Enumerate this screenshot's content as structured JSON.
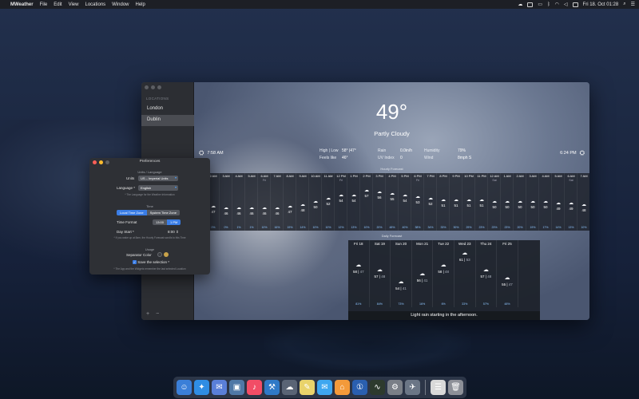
{
  "menubar": {
    "app_name": "MWeather",
    "menus": [
      "File",
      "Edit",
      "View",
      "Locations",
      "Window",
      "Help"
    ],
    "clock": "Fri 18. Oct 01:28"
  },
  "sidebar": {
    "header": "LOCATIONS",
    "items": [
      {
        "label": "London",
        "selected": false
      },
      {
        "label": "Dublin",
        "selected": true
      }
    ],
    "add": "+",
    "remove": "−"
  },
  "current": {
    "temperature": "49°",
    "condition": "Partly Cloudy",
    "sunrise": "7:58 AM",
    "sunset": "6:24 PM",
    "high_low_label": "High | Low",
    "high_low_value": "58° |47°",
    "feels_like_label": "Feels like",
    "feels_like_value": "46°",
    "rain_label": "Rain",
    "rain_value": "0.0in/h",
    "uv_label": "UV Index",
    "uv_value": "0",
    "humidity_label": "Humidity",
    "humidity_value": "79%",
    "wind_label": "Wind",
    "wind_value": "8mph S"
  },
  "hourly": {
    "title": "Hourly Forecast",
    "hours": [
      {
        "t": "1 AM",
        "d": "",
        "temp": "49",
        "rain": "1%"
      },
      {
        "t": "2 AM",
        "d": "",
        "temp": "47",
        "rain": "0%"
      },
      {
        "t": "3 AM",
        "d": "",
        "temp": "46",
        "rain": "0%"
      },
      {
        "t": "4 AM",
        "d": "",
        "temp": "46",
        "rain": "1%"
      },
      {
        "t": "5 AM",
        "d": "",
        "temp": "46",
        "rain": "1%"
      },
      {
        "t": "6 AM",
        "d": "Fri",
        "temp": "46",
        "rain": "10%"
      },
      {
        "t": "7 AM",
        "d": "",
        "temp": "46",
        "rain": "16%"
      },
      {
        "t": "8 AM",
        "d": "",
        "temp": "47",
        "rain": "19%"
      },
      {
        "t": "9 AM",
        "d": "",
        "temp": "48",
        "rain": "14%"
      },
      {
        "t": "10 AM",
        "d": "",
        "temp": "50",
        "rain": "10%"
      },
      {
        "t": "11 AM",
        "d": "",
        "temp": "52",
        "rain": "10%"
      },
      {
        "t": "12 PM",
        "d": "Fri",
        "temp": "54",
        "rain": "12%"
      },
      {
        "t": "1 PM",
        "d": "",
        "temp": "54",
        "rain": "13%"
      },
      {
        "t": "2 PM",
        "d": "",
        "temp": "57",
        "rain": "10%"
      },
      {
        "t": "3 PM",
        "d": "",
        "temp": "56",
        "rain": "20%"
      },
      {
        "t": "4 PM",
        "d": "",
        "temp": "55",
        "rain": "48%"
      },
      {
        "t": "5 PM",
        "d": "",
        "temp": "54",
        "rain": "40%"
      },
      {
        "t": "6 PM",
        "d": "Fri",
        "temp": "53",
        "rain": "38%"
      },
      {
        "t": "7 PM",
        "d": "",
        "temp": "52",
        "rain": "34%"
      },
      {
        "t": "8 PM",
        "d": "",
        "temp": "51",
        "rain": "33%"
      },
      {
        "t": "9 PM",
        "d": "",
        "temp": "51",
        "rain": "30%"
      },
      {
        "t": "10 PM",
        "d": "",
        "temp": "51",
        "rain": "29%"
      },
      {
        "t": "11 PM",
        "d": "",
        "temp": "51",
        "rain": "23%"
      },
      {
        "t": "12 AM",
        "d": "Sat",
        "temp": "50",
        "rain": "23%"
      },
      {
        "t": "1 AM",
        "d": "",
        "temp": "50",
        "rain": "23%"
      },
      {
        "t": "2 AM",
        "d": "",
        "temp": "50",
        "rain": "20%"
      },
      {
        "t": "3 AM",
        "d": "",
        "temp": "50",
        "rain": "19%"
      },
      {
        "t": "4 AM",
        "d": "",
        "temp": "50",
        "rain": "17%"
      },
      {
        "t": "5 AM",
        "d": "",
        "temp": "49",
        "rain": "14%"
      },
      {
        "t": "6 AM",
        "d": "Sat",
        "temp": "49",
        "rain": "13%"
      },
      {
        "t": "7 AM",
        "d": "",
        "temp": "48",
        "rain": "10%"
      }
    ]
  },
  "daily": {
    "title": "Daily Forecast",
    "days": [
      {
        "d": "Fri 18",
        "hi": "58",
        "lo": "47",
        "rain": "81%"
      },
      {
        "d": "Sat 19",
        "hi": "57",
        "lo": "48",
        "rain": "84%"
      },
      {
        "d": "Sun 20",
        "hi": "54",
        "lo": "41",
        "rain": "73%"
      },
      {
        "d": "Mon 21",
        "hi": "56",
        "lo": "41",
        "rain": "16%"
      },
      {
        "d": "Tue 22",
        "hi": "58",
        "lo": "48",
        "rain": "6%"
      },
      {
        "d": "Wed 23",
        "hi": "61",
        "lo": "53",
        "rain": "33%"
      },
      {
        "d": "Thu 24",
        "hi": "57",
        "lo": "48",
        "rain": "57%"
      },
      {
        "d": "Fri 25",
        "hi": "55",
        "lo": "47",
        "rain": "48%"
      }
    ],
    "summary": "Light rain starting in the afternoon."
  },
  "prefs": {
    "title": "Preferences",
    "units_header": "Units / Language",
    "units_label": "Units",
    "units_value": "US – Imperial Units",
    "language_label": "Language *",
    "language_value": "English",
    "language_note": "* The Language for the Weather Information",
    "time_header": "Time",
    "tz_local": "Local Time Zone",
    "tz_system": "System Time Zone",
    "time_format_label": "Time Format",
    "fmt_24": "13:00",
    "fmt_12": "1 PM",
    "day_start_label": "Day Start *",
    "day_start_value": "8:00",
    "day_start_note": "* If you wake up at 8am, the Hourly Forecast scrolls to this Time",
    "usage_header": "Usage",
    "separator_label": "Separator Color",
    "save_label": "Save the selection *",
    "save_note": "* The App and the Widgets remember the last selected Location",
    "accent": "#3a7de6"
  },
  "dock": {
    "apps": [
      {
        "name": "finder-icon",
        "glyph": "☺",
        "color": "#3b7fd8"
      },
      {
        "name": "safari-icon",
        "glyph": "✦",
        "color": "#2f8de4"
      },
      {
        "name": "mail-icon",
        "glyph": "✉",
        "color": "#5a7fd8"
      },
      {
        "name": "photos-icon",
        "glyph": "▣",
        "color": "#4f78a6"
      },
      {
        "name": "music-icon",
        "glyph": "♪",
        "color": "#f24d66"
      },
      {
        "name": "xcode-icon",
        "glyph": "⚒",
        "color": "#2f79c7"
      },
      {
        "name": "mweather-icon",
        "glyph": "☁",
        "color": "#5a6475"
      },
      {
        "name": "notes-icon",
        "glyph": "✎",
        "color": "#e9d36b"
      },
      {
        "name": "messages-icon",
        "glyph": "✉",
        "color": "#3ea7f0"
      },
      {
        "name": "home-icon",
        "glyph": "⌂",
        "color": "#f39a3a"
      },
      {
        "name": "onepassword-icon",
        "glyph": "①",
        "color": "#2a5fb0"
      },
      {
        "name": "activity-monitor-icon",
        "glyph": "∿",
        "color": "#2d3a2d"
      },
      {
        "name": "system-preferences-icon",
        "glyph": "⚙",
        "color": "#7a7f87"
      },
      {
        "name": "launchpad-icon",
        "glyph": "✈",
        "color": "#6b7686"
      }
    ],
    "trailing": [
      {
        "name": "document-icon",
        "glyph": "☰",
        "color": "#d9d9d9"
      },
      {
        "name": "trash-icon",
        "glyph": "🗑",
        "color": "#8d9098"
      }
    ]
  }
}
